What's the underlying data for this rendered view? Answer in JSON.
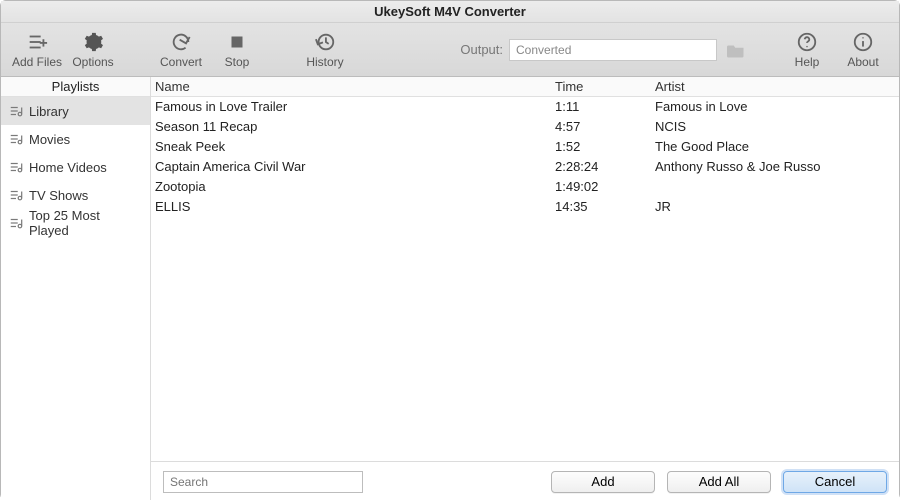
{
  "app_title": "UkeySoft M4V Converter",
  "toolbar": {
    "add_files": "Add Files",
    "options": "Options",
    "convert": "Convert",
    "stop": "Stop",
    "history": "History",
    "output_label": "Output:",
    "output_value": "Converted",
    "help": "Help",
    "about": "About"
  },
  "sidebar": {
    "header": "Playlists",
    "items": [
      {
        "label": "Library",
        "selected": true
      },
      {
        "label": "Movies",
        "selected": false
      },
      {
        "label": "Home Videos",
        "selected": false
      },
      {
        "label": "TV Shows",
        "selected": false
      },
      {
        "label": "Top 25 Most Played",
        "selected": false
      }
    ]
  },
  "table": {
    "columns": {
      "name": "Name",
      "time": "Time",
      "artist": "Artist"
    },
    "rows": [
      {
        "name": "Famous in Love  Trailer",
        "time": "1:11",
        "artist": "Famous in Love"
      },
      {
        "name": "Season 11 Recap",
        "time": "4:57",
        "artist": "NCIS"
      },
      {
        "name": "Sneak Peek",
        "time": "1:52",
        "artist": "The Good Place"
      },
      {
        "name": "Captain America  Civil War",
        "time": "2:28:24",
        "artist": "Anthony Russo & Joe Russo"
      },
      {
        "name": "Zootopia",
        "time": "1:49:02",
        "artist": ""
      },
      {
        "name": "ELLIS",
        "time": "14:35",
        "artist": "JR"
      }
    ]
  },
  "footer": {
    "search_placeholder": "Search",
    "add": "Add",
    "add_all": "Add All",
    "cancel": "Cancel"
  }
}
